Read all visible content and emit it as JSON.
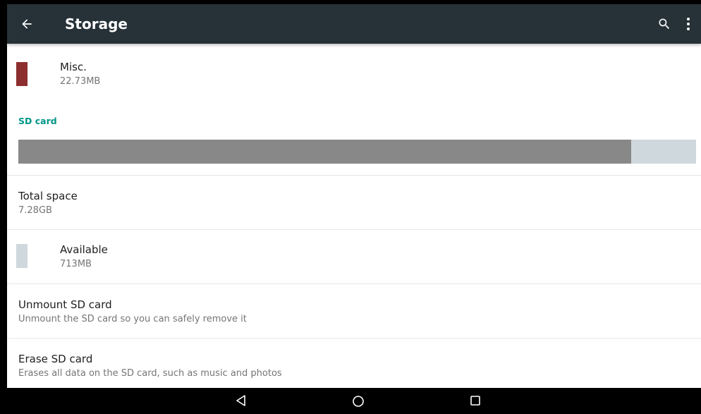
{
  "appbar": {
    "title": "Storage",
    "back_icon": "arrow-back-icon",
    "search_icon": "search-icon",
    "more_icon": "more-vert-icon",
    "background": "#263238"
  },
  "misc": {
    "label": "Misc.",
    "value": "22.73MB",
    "color": "#8d2f2f"
  },
  "sd_section": {
    "header": "SD card",
    "header_color": "#009688"
  },
  "usage_bar": {
    "used_fraction": 0.904,
    "used_color": "#888888",
    "free_color": "#cfd8dc"
  },
  "total_space": {
    "label": "Total space",
    "value": "7.28GB"
  },
  "available": {
    "label": "Available",
    "value": "713MB",
    "color": "#cfd8dc"
  },
  "unmount": {
    "label": "Unmount SD card",
    "summary": "Unmount the SD card so you can safely remove it"
  },
  "erase": {
    "label": "Erase SD card",
    "summary": "Erases all data on the SD card, such as music and photos"
  },
  "navbar": {
    "back_icon": "nav-back-icon",
    "home_icon": "nav-home-icon",
    "recents_icon": "nav-recents-icon"
  }
}
